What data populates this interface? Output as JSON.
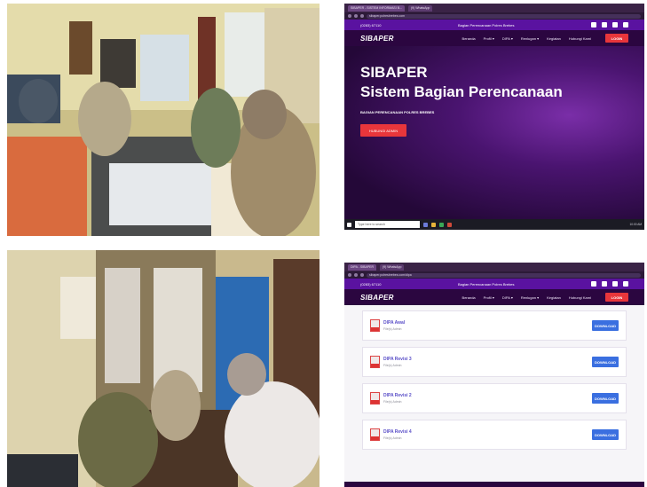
{
  "site": {
    "phone": "(0283) 67110",
    "org": "Bagian Perencanaan Polres Brebes",
    "brand": "SIBAPER",
    "login": "LOGIN",
    "menu": [
      "Beranda",
      "Profil ▾",
      "DIPA ▾",
      "Renlugan ▾",
      "Kegiatan",
      "Hubungi Kami"
    ]
  },
  "shot1": {
    "tabs": [
      "SIBAPER - SISTEM INFORMASI B...",
      "(9) WhatsApp"
    ],
    "url": "sibaper.polresbrebes.com",
    "hero_title1": "SIBAPER",
    "hero_title2": "Sistem Bagian Perencanaan",
    "hero_sub": "BAGIAN PERENCANAAN POLRES BREBES",
    "cta": "HUBUNGI ADMIN",
    "taskbar_search": "Type here to search",
    "taskbar_time": "10:00 AM"
  },
  "shot2": {
    "tabs": [
      "DIPA - SIBAPER",
      "(9) WhatsApp"
    ],
    "url": "sibaper.polresbrebes.com/dipa",
    "docs": [
      {
        "title": "DIPA Awal",
        "meta": "File(s)   Admin",
        "button": "DOWNLOAD"
      },
      {
        "title": "DIPA Revisi 3",
        "meta": "File(s)   Admin",
        "button": "DOWNLOAD"
      },
      {
        "title": "DIPA Revisi 2",
        "meta": "File(s)   Admin",
        "button": "DOWNLOAD"
      },
      {
        "title": "DIPA Revisi 4",
        "meta": "File(s)   Admin",
        "button": "DOWNLOAD"
      }
    ]
  },
  "colors": {
    "brand_purple": "#5a12a0",
    "dark_purple": "#2b0640",
    "login_red": "#e8363b",
    "download_blue": "#3a6fe0"
  }
}
